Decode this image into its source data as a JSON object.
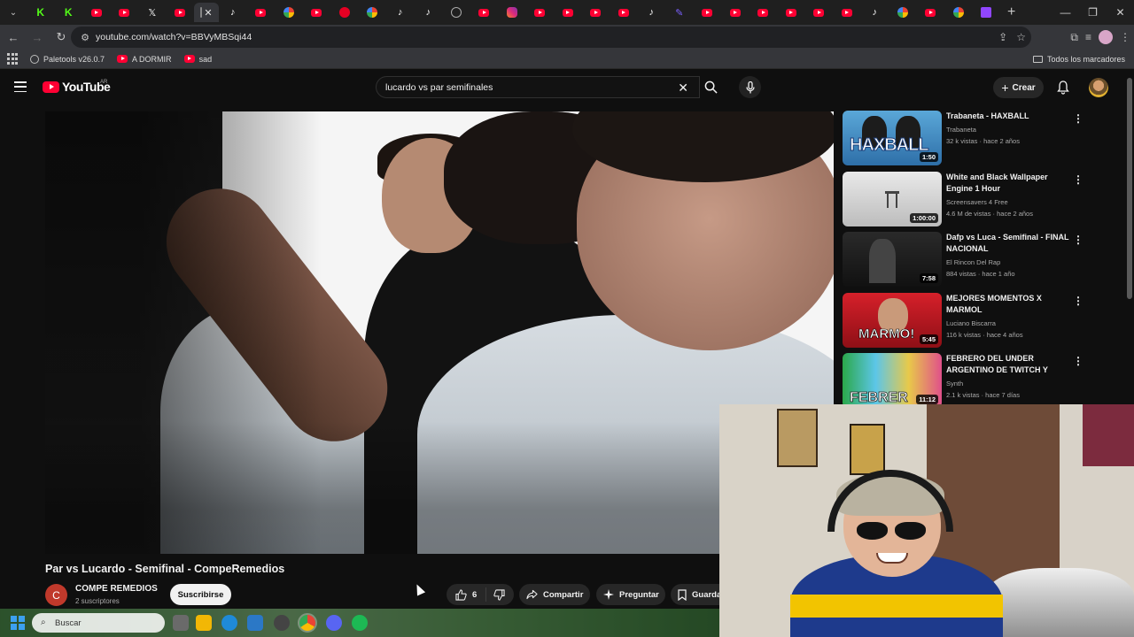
{
  "browser": {
    "tabs": [
      {
        "icon": "chevron-down-icon"
      },
      {
        "icon": "kick-icon"
      },
      {
        "icon": "kick-icon"
      },
      {
        "icon": "youtube-icon"
      },
      {
        "icon": "youtube-icon"
      },
      {
        "icon": "x-icon"
      },
      {
        "icon": "youtube-icon"
      },
      {
        "icon": "active-tab"
      },
      {
        "icon": "tiktok-icon"
      },
      {
        "icon": "youtube-icon"
      },
      {
        "icon": "google-icon"
      },
      {
        "icon": "youtube-icon"
      },
      {
        "icon": "pinterest-icon"
      },
      {
        "icon": "google-icon"
      },
      {
        "icon": "tiktok-icon"
      },
      {
        "icon": "tiktok-icon"
      },
      {
        "icon": "circle-icon"
      },
      {
        "icon": "youtube-icon"
      },
      {
        "icon": "instagram-icon"
      },
      {
        "icon": "youtube-icon"
      },
      {
        "icon": "youtube-icon"
      },
      {
        "icon": "youtube-icon"
      },
      {
        "icon": "youtube-icon"
      },
      {
        "icon": "tiktok-icon"
      },
      {
        "icon": "pen-icon"
      },
      {
        "icon": "youtube-icon"
      },
      {
        "icon": "youtube-icon"
      },
      {
        "icon": "youtube-icon"
      },
      {
        "icon": "youtube-icon"
      },
      {
        "icon": "youtube-icon"
      },
      {
        "icon": "youtube-icon"
      },
      {
        "icon": "tiktok-icon"
      },
      {
        "icon": "google-icon"
      },
      {
        "icon": "youtube-icon"
      },
      {
        "icon": "google-icon"
      },
      {
        "icon": "twitch-icon"
      }
    ],
    "url": "youtube.com/watch?v=BBVyMBSqi44",
    "bookmarks": [
      {
        "label": "Paletools v26.0.7",
        "icon": "globe-icon"
      },
      {
        "label": "A DORMIR",
        "icon": "youtube-icon"
      },
      {
        "label": "sad",
        "icon": "youtube-icon"
      }
    ],
    "all_bookmarks": "Todos los marcadores"
  },
  "youtube": {
    "logo_text": "YouTube",
    "country_code": "AR",
    "search_query": "lucardo vs par semifinales",
    "create_label": "Crear",
    "video": {
      "title": "Par vs Lucardo - Semifinal - CompeRemedios",
      "channel_initial": "C",
      "channel_name": "COMPE REMEDIOS",
      "subscribers": "2 suscriptores",
      "subscribe_label": "Suscribirse",
      "likes": "6",
      "share_label": "Compartir",
      "ask_label": "Preguntar",
      "save_label": "Guarda"
    },
    "recommendations": [
      {
        "title": "Trabaneta - HAXBALL",
        "channel": "Trabaneta",
        "meta": "32 k vistas · hace 2 años",
        "duration": "1:50",
        "thumb_text": "HAXBALL"
      },
      {
        "title": "White and Black Wallpaper Engine 1 Hour",
        "channel": "Screensavers 4 Free",
        "meta": "4.6 M de vistas · hace 2 años",
        "duration": "1:00:00"
      },
      {
        "title": "Dafp vs Luca - Semifinal - FINAL NACIONAL",
        "channel": "El Rincon Del Rap",
        "meta": "884 vistas · hace 1 año",
        "duration": "7:58"
      },
      {
        "title": "MEJORES MOMENTOS X MARMOL",
        "channel": "Luciano Biscarra",
        "meta": "116 k vistas · hace 4 años",
        "duration": "5:45",
        "thumb_text": "MARMO!"
      },
      {
        "title": "FEBRERO DEL UNDER ARGENTINO DE TWITCH Y KIC...",
        "channel": "Synth",
        "meta": "2.1 k vistas · hace 7 días",
        "duration": "11:12",
        "thumb_text": "FEBRER"
      }
    ]
  },
  "taskbar": {
    "search_placeholder": "Buscar"
  },
  "colors": {
    "youtube_red": "#ff0033",
    "background": "#0f0f0f",
    "pill": "#272727"
  }
}
